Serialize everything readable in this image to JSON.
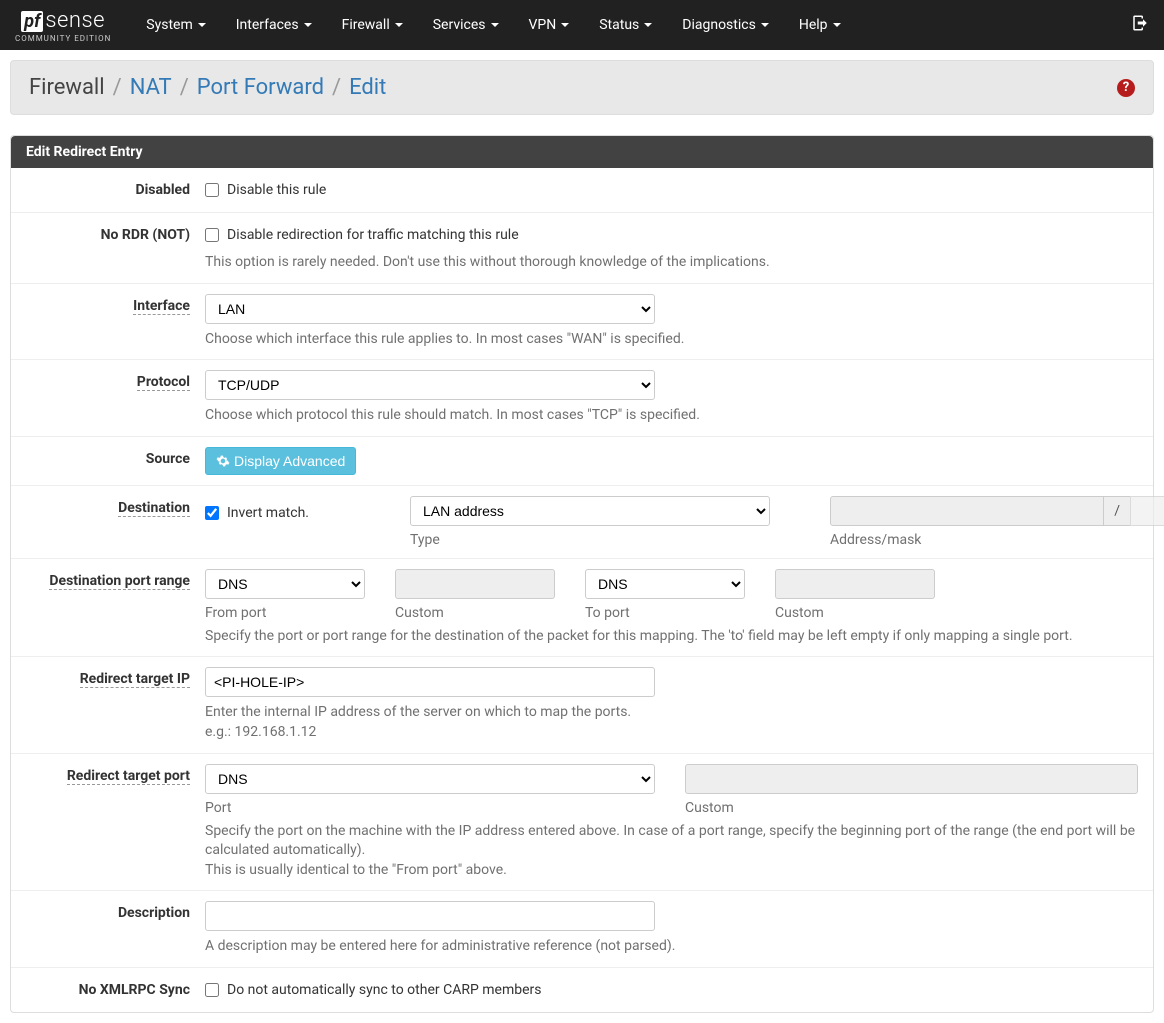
{
  "brand": {
    "pf": "pf",
    "sense": "sense",
    "sub": "COMMUNITY EDITION"
  },
  "nav": [
    "System",
    "Interfaces",
    "Firewall",
    "Services",
    "VPN",
    "Status",
    "Diagnostics",
    "Help"
  ],
  "breadcrumb": {
    "p0": "Firewall",
    "p1": "NAT",
    "p2": "Port Forward",
    "p3": "Edit"
  },
  "panel_title": "Edit Redirect Entry",
  "labels": {
    "disabled": "Disabled",
    "nordr": "No RDR (NOT)",
    "interface": "Interface",
    "protocol": "Protocol",
    "source": "Source",
    "destination": "Destination",
    "dest_port_range": "Destination port range",
    "redirect_ip": "Redirect target IP",
    "redirect_port": "Redirect target port",
    "description": "Description",
    "noxmlrpc": "No XMLRPC Sync"
  },
  "checkbox_labels": {
    "disabled": "Disable this rule",
    "nordr": "Disable redirection for traffic matching this rule",
    "invert": "Invert match.",
    "noxmlrpc": "Do not automatically sync to other CARP members"
  },
  "values": {
    "interface": "LAN",
    "protocol": "TCP/UDP",
    "dest_type": "LAN address",
    "from_port": "DNS",
    "to_port": "DNS",
    "redirect_ip": "<PI-HOLE-IP>",
    "redirect_port": "DNS",
    "mask_sep": "/"
  },
  "helps": {
    "nordr": "This option is rarely needed. Don't use this without thorough knowledge of the implications.",
    "interface": "Choose which interface this rule applies to. In most cases \"WAN\" is specified.",
    "protocol": "Choose which protocol this rule should match. In most cases \"TCP\" is specified.",
    "dest_port": "Specify the port or port range for the destination of the packet for this mapping. The 'to' field may be left empty if only mapping a single port.",
    "redirect_ip_1": "Enter the internal IP address of the server on which to map the ports.",
    "redirect_ip_2": "e.g.: 192.168.1.12",
    "redirect_port_1": "Specify the port on the machine with the IP address entered above. In case of a port range, specify the beginning port of the range (the end port will be calculated automatically).",
    "redirect_port_2": "This is usually identical to the \"From port\" above.",
    "description": "A description may be entered here for administrative reference (not parsed)."
  },
  "sublabels": {
    "type": "Type",
    "addr_mask": "Address/mask",
    "from_port": "From port",
    "custom": "Custom",
    "to_port": "To port",
    "port": "Port"
  },
  "buttons": {
    "display_advanced": "Display Advanced"
  }
}
